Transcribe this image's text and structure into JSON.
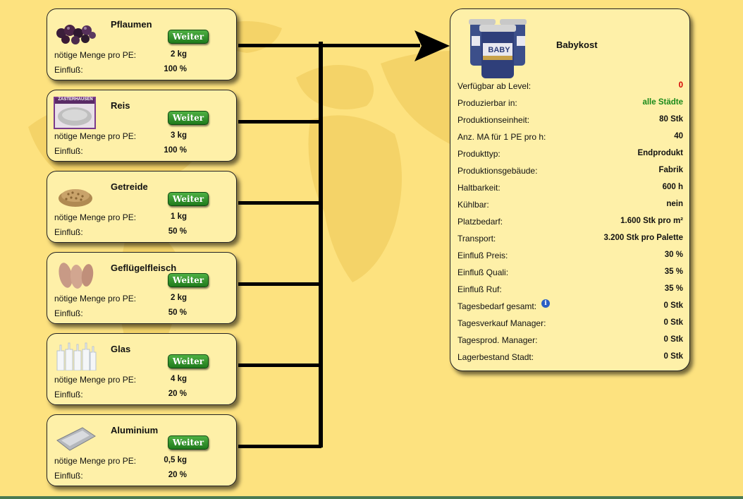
{
  "ingredients": [
    {
      "name": "Pflaumen",
      "button": "Weiter",
      "menge_label": "nötige Menge pro PE:",
      "menge": "2 kg",
      "einfluss_label": "Einfluß:",
      "einfluss": "100 %"
    },
    {
      "name": "Reis",
      "button": "Weiter",
      "menge_label": "nötige Menge pro PE:",
      "menge": "3 kg",
      "einfluss_label": "Einfluß:",
      "einfluss": "100 %",
      "thumb_text": "ZASTERHAUSEN"
    },
    {
      "name": "Getreide",
      "button": "Weiter",
      "menge_label": "nötige Menge pro PE:",
      "menge": "1 kg",
      "einfluss_label": "Einfluß:",
      "einfluss": "50 %"
    },
    {
      "name": "Geflügelfleisch",
      "button": "Weiter",
      "menge_label": "nötige Menge pro PE:",
      "menge": "2 kg",
      "einfluss_label": "Einfluß:",
      "einfluss": "50 %"
    },
    {
      "name": "Glas",
      "button": "Weiter",
      "menge_label": "nötige Menge pro PE:",
      "menge": "4 kg",
      "einfluss_label": "Einfluß:",
      "einfluss": "20 %"
    },
    {
      "name": "Aluminium",
      "button": "Weiter",
      "menge_label": "nötige Menge pro PE:",
      "menge": "0,5 kg",
      "einfluss_label": "Einfluß:",
      "einfluss": "20 %"
    }
  ],
  "product": {
    "title": "Babykost",
    "jar_label": "BABY",
    "rows": [
      {
        "label": "Verfügbar ab Level:",
        "value": "0",
        "color": "#d40000"
      },
      {
        "label": "Produzierbar in:",
        "value": "alle Städte",
        "color": "#1a8a1a"
      },
      {
        "label": "Produktionseinheit:",
        "value": "80 Stk"
      },
      {
        "label": "Anz. MA für 1 PE pro h:",
        "value": "40"
      },
      {
        "label": "Produkttyp:",
        "value": "Endprodukt"
      },
      {
        "label": "Produktionsgebäude:",
        "value": "Fabrik"
      },
      {
        "label": "Haltbarkeit:",
        "value": "600 h"
      },
      {
        "label": "Kühlbar:",
        "value": "nein"
      },
      {
        "label": "Platzbedarf:",
        "value": "1.600 Stk pro m²"
      },
      {
        "label": "Transport:",
        "value": "3.200 Stk pro Palette"
      },
      {
        "label": "Einfluß Preis:",
        "value": "30 %"
      },
      {
        "label": "Einfluß Quali:",
        "value": "35 %"
      },
      {
        "label": "Einfluß Ruf:",
        "value": "35 %"
      },
      {
        "label": "Tagesbedarf gesamt:",
        "value": "0 Stk",
        "info_icon": "info-icon"
      },
      {
        "label": "Tagesverkauf Manager:",
        "value": "0 Stk"
      },
      {
        "label": "Tagesprod. Manager:",
        "value": "0 Stk"
      },
      {
        "label": "Lagerbestand Stadt:",
        "value": "0 Stk"
      }
    ]
  },
  "colors": {
    "background": "#fde27f",
    "card": "#fef0a8",
    "button": "#2f8f2a",
    "level": "#d40000",
    "cities": "#1a8a1a"
  }
}
